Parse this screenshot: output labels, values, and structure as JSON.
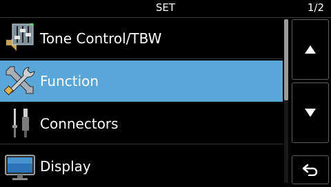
{
  "header": {
    "title": "SET",
    "page": "1/2"
  },
  "menu": {
    "items": [
      {
        "label": "Tone Control/TBW",
        "icon": "tone-control-icon",
        "selected": false
      },
      {
        "label": "Function",
        "icon": "tools-icon",
        "selected": true
      },
      {
        "label": "Connectors",
        "icon": "connector-icon",
        "selected": false
      },
      {
        "label": "Display",
        "icon": "display-icon",
        "selected": false
      }
    ]
  },
  "controls": {
    "up_icon": "up-arrow-icon",
    "down_icon": "down-arrow-icon",
    "back_icon": "back-arrow-icon"
  },
  "colors": {
    "selected_bg": "#5aa6d6",
    "background": "#000000",
    "border": "#5c5c5c"
  }
}
